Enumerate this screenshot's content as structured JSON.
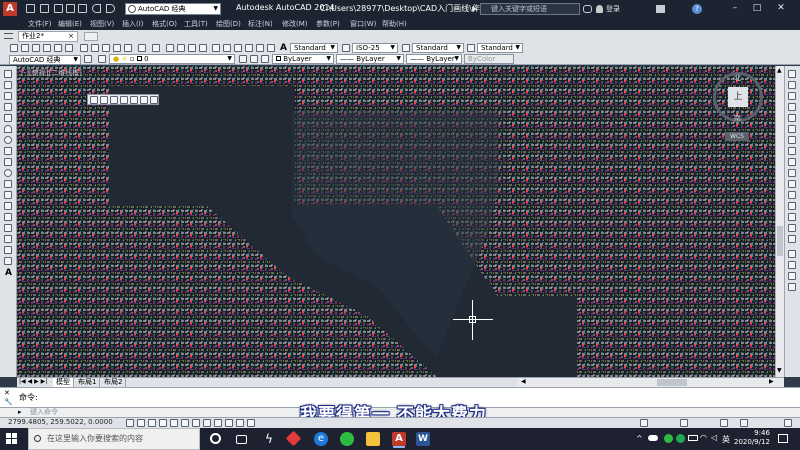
{
  "window": {
    "workspace": "AutoCAD 经典",
    "app_title": "Autodesk AutoCAD 2014",
    "file_path": "C:\\Users\\28977\\Desktop\\CAD入门画线\\作业2.dwg",
    "search_placeholder": "键入关键字或短语",
    "login_label": "登录"
  },
  "menu": [
    "文件(F)",
    "编辑(E)",
    "视图(V)",
    "插入(I)",
    "格式(O)",
    "工具(T)",
    "绘图(D)",
    "标注(N)",
    "修改(M)",
    "参数(P)",
    "窗口(W)",
    "帮助(H)"
  ],
  "doc_tab": {
    "label": "作业2*",
    "close": "×"
  },
  "styles_toolbar": {
    "text_style": "Standard",
    "dim_style": "ISO-25",
    "table_style": "Standard",
    "multileader_style": "Standard"
  },
  "layer_toolbar": {
    "workspace": "AutoCAD 经典",
    "layer": "0",
    "color": "ByLayer",
    "linetype": "ByLayer",
    "lineweight": "ByLayer",
    "plot_style": "ByColor"
  },
  "viewport_label": "[-][俯视][二维线框]",
  "viewcube": {
    "face": "上",
    "n": "北",
    "s": "南",
    "wcs": "WCS"
  },
  "layout_tabs": [
    "模型",
    "布局1",
    "布局2"
  ],
  "command": {
    "history_label": "命令:",
    "input_placeholder": "键入命令"
  },
  "subtitle": "我要得第一 不能太费力",
  "status": {
    "coordinates": "2799.4805, 259.5022, 0.0000"
  },
  "taskbar": {
    "search_placeholder": "在这里输入你要搜索的内容",
    "lang": "英",
    "time": "9:46",
    "date": "2020/9/12"
  },
  "colors": {
    "title_bg": "#1c2431",
    "canvas_bg": "#212935",
    "toolbar_bg": "#dfe3e8",
    "accent": "#1a2a8a"
  }
}
